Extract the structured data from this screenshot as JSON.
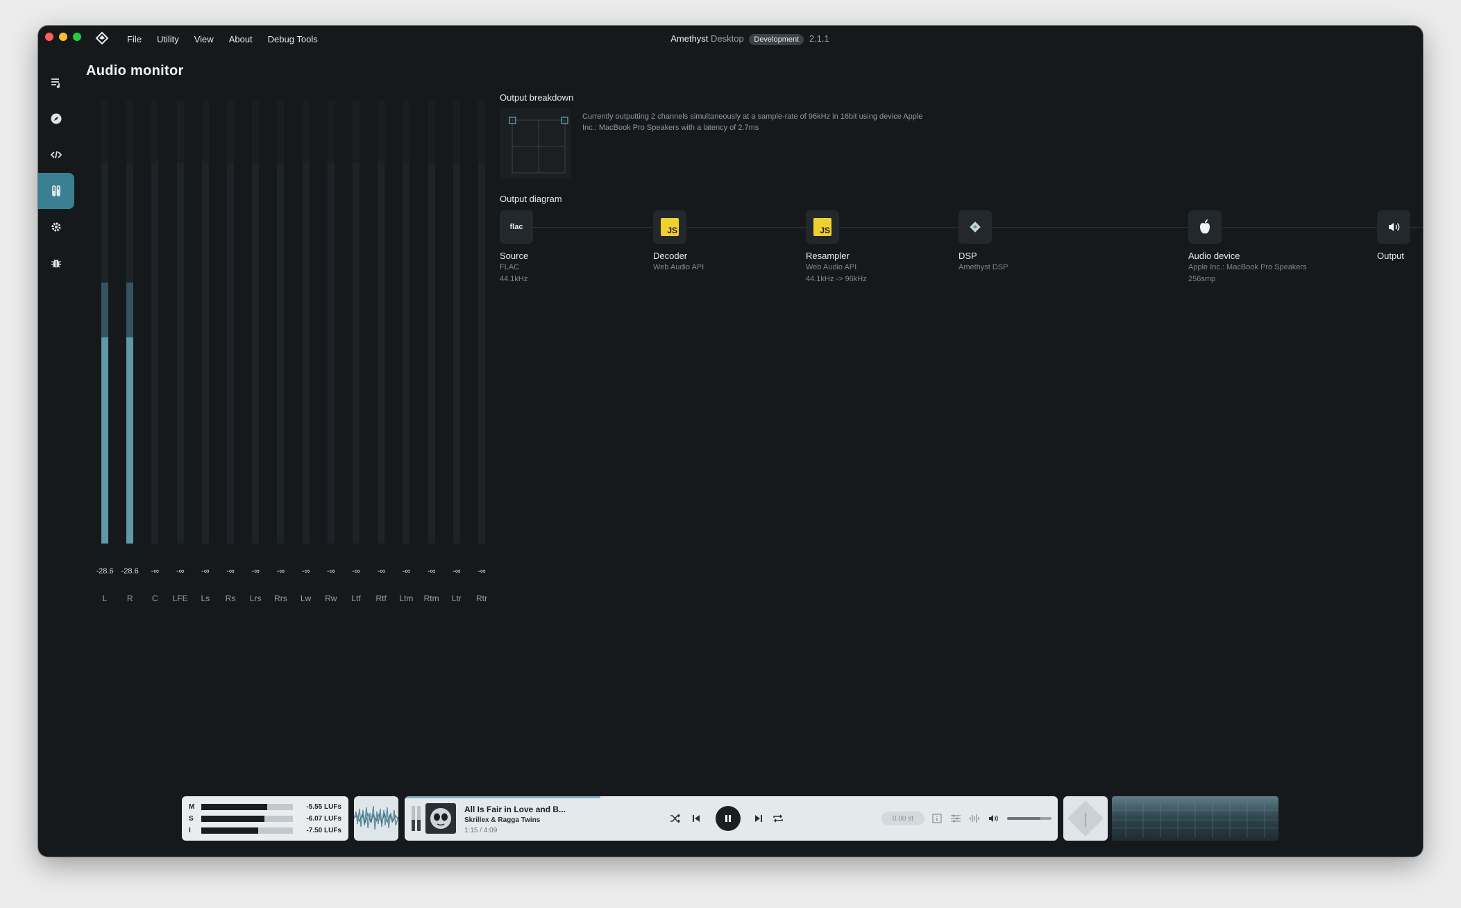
{
  "window": {
    "app_name": "Amethyst",
    "app_suffix": "Desktop",
    "build_badge": "Development",
    "version": "2.1.1"
  },
  "menu": [
    "File",
    "Utility",
    "View",
    "About",
    "Debug Tools"
  ],
  "sidebar": [
    {
      "icon": "queue-icon"
    },
    {
      "icon": "compass-icon"
    },
    {
      "icon": "code-icon"
    },
    {
      "icon": "audio-monitor-icon",
      "active": true
    },
    {
      "icon": "gear-icon"
    },
    {
      "icon": "bug-icon"
    }
  ],
  "page": {
    "title": "Audio monitor"
  },
  "meters": {
    "channels": [
      {
        "label": "L",
        "value": "-28.6",
        "level": 0.465,
        "peak": 0.59
      },
      {
        "label": "R",
        "value": "-28.6",
        "level": 0.465,
        "peak": 0.59
      },
      {
        "label": "C",
        "value": "-∞",
        "level": 0,
        "peak": 0
      },
      {
        "label": "LFE",
        "value": "-∞",
        "level": 0,
        "peak": 0
      },
      {
        "label": "Ls",
        "value": "-∞",
        "level": 0,
        "peak": 0
      },
      {
        "label": "Rs",
        "value": "-∞",
        "level": 0,
        "peak": 0
      },
      {
        "label": "Lrs",
        "value": "-∞",
        "level": 0,
        "peak": 0
      },
      {
        "label": "Rrs",
        "value": "-∞",
        "level": 0,
        "peak": 0
      },
      {
        "label": "Lw",
        "value": "-∞",
        "level": 0,
        "peak": 0
      },
      {
        "label": "Rw",
        "value": "-∞",
        "level": 0,
        "peak": 0
      },
      {
        "label": "Ltf",
        "value": "-∞",
        "level": 0,
        "peak": 0
      },
      {
        "label": "Rtf",
        "value": "-∞",
        "level": 0,
        "peak": 0
      },
      {
        "label": "Ltm",
        "value": "-∞",
        "level": 0,
        "peak": 0
      },
      {
        "label": "Rtm",
        "value": "-∞",
        "level": 0,
        "peak": 0
      },
      {
        "label": "Ltr",
        "value": "-∞",
        "level": 0,
        "peak": 0
      },
      {
        "label": "Rtr",
        "value": "-∞",
        "level": 0,
        "peak": 0
      }
    ]
  },
  "output_breakdown": {
    "label": "Output breakdown",
    "description": "Currently outputting 2 channels simultaneously at a sample-rate of 96kHz in 16bit using device Apple Inc.: MacBook Pro Speakers with a latency of 2.7ms"
  },
  "output_diagram": {
    "label": "Output diagram",
    "nodes": [
      {
        "title": "Source",
        "sub1": "FLAC",
        "sub2": "44.1kHz",
        "icon": "flac-icon",
        "icon_text": "flac"
      },
      {
        "title": "Decoder",
        "sub1": "Web Audio API",
        "sub2": "",
        "icon": "javascript-icon",
        "icon_text": "JS"
      },
      {
        "title": "Resampler",
        "sub1": "Web Audio API",
        "sub2": "44.1kHz -> 96kHz",
        "icon": "javascript-icon",
        "icon_text": "JS"
      },
      {
        "title": "DSP",
        "sub1": "Amethyst DSP",
        "sub2": "",
        "icon": "amethyst-icon"
      },
      {
        "title": "Audio device",
        "sub1": "Apple Inc.: MacBook Pro Speakers",
        "sub2": "256smp",
        "icon": "apple-icon"
      },
      {
        "title": "Output",
        "sub1": "",
        "sub2": "",
        "icon": "speaker-icon"
      }
    ]
  },
  "loudness": {
    "rows": [
      {
        "key": "M",
        "value": "-5.55 LUFs",
        "level": 0.72
      },
      {
        "key": "S",
        "value": "-6.07 LUFs",
        "level": 0.69
      },
      {
        "key": "I",
        "value": "-7.50 LUFs",
        "level": 0.62
      }
    ]
  },
  "player": {
    "title": "All Is Fair in Love and B...",
    "artist": "Skrillex & Ragga Twins",
    "time": "1:15 / 4:09",
    "progress": 0.3,
    "gain": "0.00 st",
    "volume": 0.75
  },
  "colors": {
    "accent": "#3b7f92",
    "meter_fill": "#5f98a8",
    "window_bg": "#16191c"
  }
}
